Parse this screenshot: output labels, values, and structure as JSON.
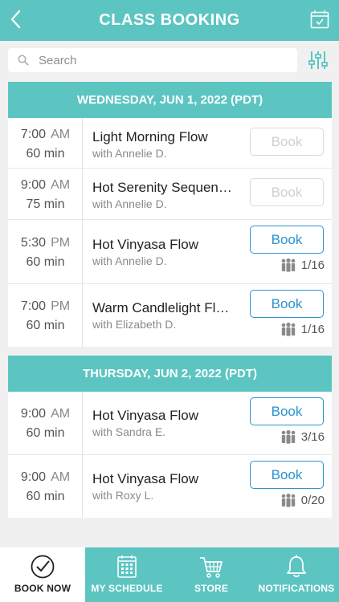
{
  "header": {
    "title": "CLASS BOOKING"
  },
  "search": {
    "placeholder": "Search"
  },
  "days": [
    {
      "date": "WEDNESDAY, JUN 1, 2022 (PDT)",
      "classes": [
        {
          "time": "7:00",
          "ampm": "AM",
          "duration": "60 min",
          "name": "Light Morning Flow",
          "instructor": "with Annelie D.",
          "book": "Book",
          "bookable": false,
          "capacity": ""
        },
        {
          "time": "9:00",
          "ampm": "AM",
          "duration": "75 min",
          "name": "Hot Serenity Sequen…",
          "instructor": "with Annelie D.",
          "book": "Book",
          "bookable": false,
          "capacity": ""
        },
        {
          "time": "5:30",
          "ampm": "PM",
          "duration": "60 min",
          "name": "Hot Vinyasa Flow",
          "instructor": "with Annelie D.",
          "book": "Book",
          "bookable": true,
          "capacity": "1/16"
        },
        {
          "time": "7:00",
          "ampm": "PM",
          "duration": "60 min",
          "name": "Warm Candlelight Fl…",
          "instructor": "with Elizabeth D.",
          "book": "Book",
          "bookable": true,
          "capacity": "1/16"
        }
      ]
    },
    {
      "date": "THURSDAY, JUN 2, 2022 (PDT)",
      "classes": [
        {
          "time": "9:00",
          "ampm": "AM",
          "duration": "60 min",
          "name": "Hot Vinyasa Flow",
          "instructor": "with Sandra E.",
          "book": "Book",
          "bookable": true,
          "capacity": "3/16"
        },
        {
          "time": "9:00",
          "ampm": "AM",
          "duration": "60 min",
          "name": "Hot Vinyasa Flow",
          "instructor": "with Roxy L.",
          "book": "Book",
          "bookable": true,
          "capacity": "0/20"
        }
      ]
    }
  ],
  "tabs": [
    {
      "label": "BOOK NOW",
      "icon": "check-circle-icon",
      "active": true
    },
    {
      "label": "MY SCHEDULE",
      "icon": "calendar-icon",
      "active": false
    },
    {
      "label": "STORE",
      "icon": "cart-icon",
      "active": false
    },
    {
      "label": "NOTIFICATIONS",
      "icon": "bell-icon",
      "active": false
    }
  ],
  "colors": {
    "accent": "#5cc5c2",
    "button": "#2a93cf",
    "disabled": "#d9d9d9"
  }
}
